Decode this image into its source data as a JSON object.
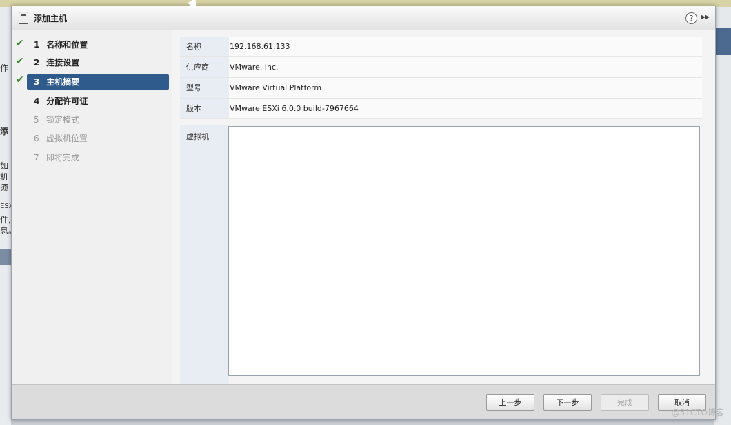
{
  "dialog": {
    "title": "添加主机",
    "help_glyph": "?",
    "expand_glyph": "▸▸"
  },
  "steps": [
    {
      "number": "1",
      "label": "名称和位置",
      "state": "completed"
    },
    {
      "number": "2",
      "label": "连接设置",
      "state": "completed"
    },
    {
      "number": "3",
      "label": "主机摘要",
      "state": "active"
    },
    {
      "number": "4",
      "label": "分配许可证",
      "state": "pending"
    },
    {
      "number": "5",
      "label": "锁定模式",
      "state": "disabled"
    },
    {
      "number": "6",
      "label": "虚拟机位置",
      "state": "disabled"
    },
    {
      "number": "7",
      "label": "即将完成",
      "state": "disabled"
    }
  ],
  "check_glyph": "✔",
  "summary": {
    "rows": [
      {
        "label": "名称",
        "value": "192.168.61.133"
      },
      {
        "label": "供应商",
        "value": "VMware, Inc."
      },
      {
        "label": "型号",
        "value": "VMware Virtual Platform"
      },
      {
        "label": "版本",
        "value": "VMware ESXi 6.0.0 build-7967664"
      }
    ],
    "vm_label": "虚拟机",
    "vm_items": []
  },
  "buttons": {
    "back": "上一步",
    "next": "下一步",
    "finish": "完成",
    "cancel": "取消"
  },
  "background": {
    "left_glyphs": [
      "作",
      "添",
      "如",
      "机",
      "须",
      "ESX",
      "件,",
      "息。"
    ]
  },
  "watermark": "@51CTO博客"
}
